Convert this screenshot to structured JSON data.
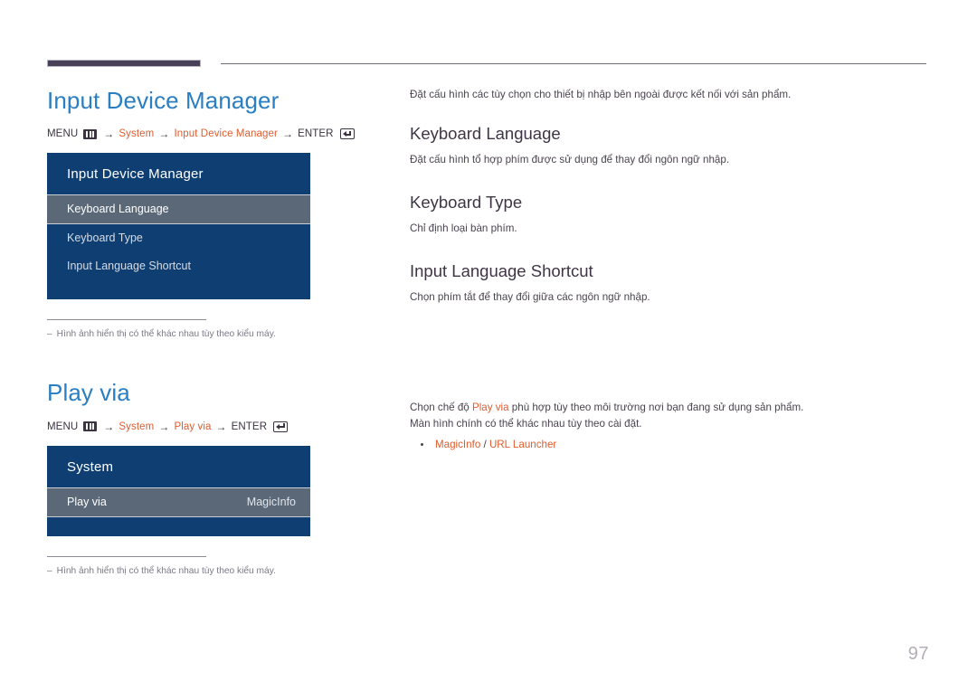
{
  "page": {
    "number": "97"
  },
  "sections": [
    {
      "title": "Input Device Manager",
      "breadcrumb": {
        "menu_label": "MENU",
        "menu_icon": "menu-grid-icon",
        "arrow": "→",
        "path": [
          "System",
          "Input Device Manager"
        ],
        "enter_label": "ENTER",
        "enter_icon": "enter-key-icon"
      },
      "osd": {
        "header": "Input Device Manager",
        "rows": [
          {
            "label": "Keyboard Language",
            "value": "",
            "selected": true
          },
          {
            "label": "Keyboard Type",
            "value": "",
            "selected": false
          },
          {
            "label": "Input Language Shortcut",
            "value": "",
            "selected": false
          }
        ]
      },
      "footnote": {
        "dash": "‒",
        "text": "Hình ảnh hiển thị có thể khác nhau tùy theo kiểu máy."
      }
    },
    {
      "title": "Play via",
      "breadcrumb": {
        "menu_label": "MENU",
        "menu_icon": "menu-grid-icon",
        "arrow": "→",
        "path": [
          "System",
          "Play via"
        ],
        "enter_label": "ENTER",
        "enter_icon": "enter-key-icon"
      },
      "osd": {
        "header": "System",
        "rows": [
          {
            "label": "Play via",
            "value": "MagicInfo",
            "selected": true
          }
        ]
      },
      "footnote": {
        "dash": "‒",
        "text": "Hình ảnh hiển thị có thể khác nhau tùy theo kiểu máy."
      }
    }
  ],
  "right": {
    "intro": "Đặt cấu hình các tùy chọn cho thiết bị nhập bên ngoài được kết nối với sản phẩm.",
    "topics": [
      {
        "heading": "Keyboard Language",
        "text": "Đặt cấu hình tổ hợp phím được sử dụng để thay đổi ngôn ngữ nhập."
      },
      {
        "heading": "Keyboard Type",
        "text": "Chỉ định loại bàn phím."
      },
      {
        "heading": "Input Language Shortcut",
        "text": "Chọn phím tắt để thay đổi giữa các ngôn ngữ nhập."
      }
    ],
    "play_via": {
      "line1_pre": "Chọn chế độ ",
      "line1_accent": "Play via",
      "line1_post": " phù hợp tùy theo môi trường nơi bạn đang sử dụng sản phẩm.",
      "line2": "Màn hình chính có thể khác nhau tùy theo cài đặt.",
      "bullets": [
        {
          "first": "MagicInfo",
          "sep": " / ",
          "second": "URL Launcher"
        }
      ]
    }
  },
  "colors": {
    "title_blue": "#2a7ec2",
    "accent_orange": "#e05c2e",
    "osd_bg": "#0f3f72",
    "osd_selected": "#5a6878",
    "heading_dark": "#3f3545",
    "page_number": "#b3aeb8"
  }
}
